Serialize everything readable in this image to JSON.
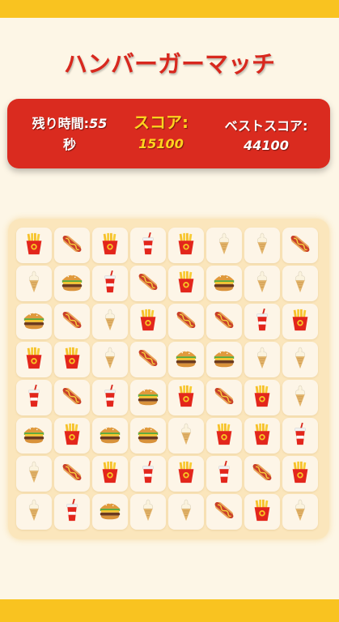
{
  "title": "ハンバーガーマッチ",
  "hud": {
    "time_label": "残り時間:",
    "time_value": "55",
    "time_unit": "秒",
    "score_label": "スコア:",
    "score_value": "15100",
    "best_label": "ベストスコア:",
    "best_value": "44100"
  },
  "colors": {
    "top_bar": "#f9c320",
    "title": "#d8281e",
    "panel": "#da2b1f",
    "score_text": "#ffd21f",
    "board": "#fbe6bc",
    "tile": "#fdf5e7",
    "page": "#fdf6e6"
  },
  "board": {
    "rows": 8,
    "cols": 8,
    "grid": [
      [
        "fries",
        "hotdog",
        "fries",
        "drink",
        "fries",
        "icecream",
        "icecream",
        "hotdog"
      ],
      [
        "icecream",
        "burger",
        "drink",
        "hotdog",
        "fries",
        "burger",
        "icecream",
        "icecream"
      ],
      [
        "burger",
        "hotdog",
        "icecream",
        "fries",
        "hotdog",
        "hotdog",
        "drink",
        "fries"
      ],
      [
        "fries",
        "fries",
        "icecream",
        "hotdog",
        "burger",
        "burger",
        "icecream",
        "icecream"
      ],
      [
        "drink",
        "hotdog",
        "drink",
        "burger",
        "fries",
        "hotdog",
        "fries",
        "icecream"
      ],
      [
        "burger",
        "fries",
        "burger",
        "burger",
        "icecream",
        "fries",
        "fries",
        "drink"
      ],
      [
        "icecream",
        "hotdog",
        "fries",
        "drink",
        "fries",
        "drink",
        "hotdog",
        "fries"
      ],
      [
        "icecream",
        "drink",
        "burger",
        "icecream",
        "icecream",
        "hotdog",
        "fries",
        "icecream"
      ]
    ]
  }
}
